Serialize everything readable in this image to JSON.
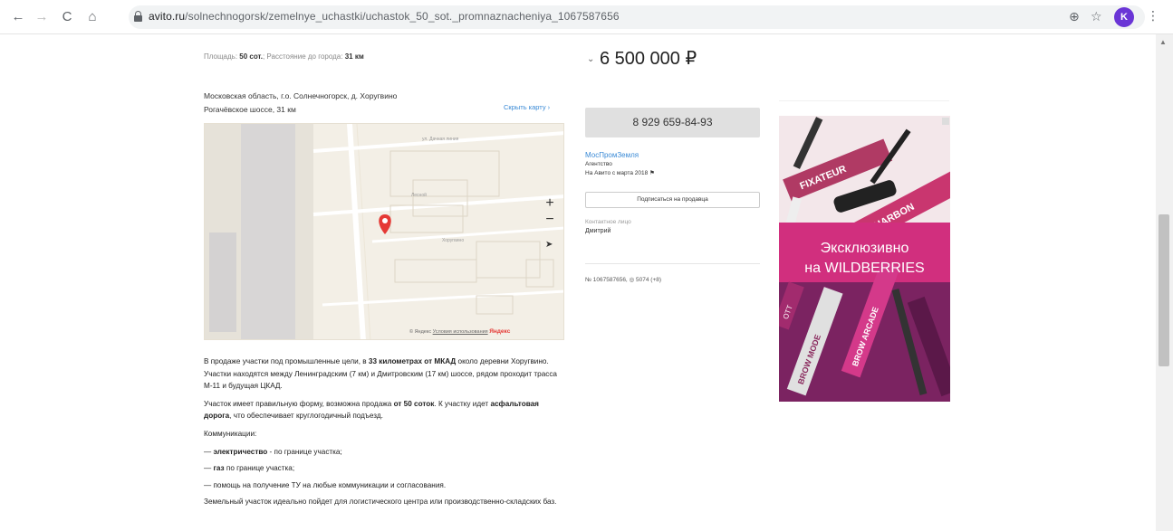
{
  "browser": {
    "url_host": "avito.ru",
    "url_path": "/solnechnogorsk/zemelnye_uchastki/uchastok_50_sot._promnaznacheniya_1067587656",
    "avatar_letter": "K"
  },
  "listing": {
    "meta_label_area": "Площадь:",
    "meta_value_area": "50 сот.",
    "meta_label_distance": "; Расстояние до города:",
    "meta_value_distance": "31 км",
    "address_line1": "Московская область, г.о. Солнечногорск, д. Хоругвино",
    "address_line2": "Рогачёвское шоссе, 31 км",
    "hide_map": "Скрыть карту",
    "map_credit_ya": "© Яндекс",
    "map_credit_terms": "Условия использования",
    "map_credit_logo": "Яндекс",
    "description": {
      "p1_a": "В продаже участки под промышленные цели, в ",
      "p1_b": "33 километрах от МКАД",
      "p1_c": " около деревни Хоругвино. Участки находятся между Ленинградским (7 км) и Дмитровским (17 км) шоссе, рядом проходит трасса М-11 и будущая ЦКАД.",
      "p2_a": "Участок имеет правильную форму, возможна продажа ",
      "p2_b": "от 50 соток",
      "p2_c": ". К участку идет ",
      "p2_d": "асфальтовая дорога",
      "p2_e": ", что обеспечивает круглогодичный подъезд.",
      "p3": "Коммуникации:",
      "l1_a": "— ",
      "l1_b": "электричество",
      "l1_c": " - по границе участка;",
      "l2_a": "— ",
      "l2_b": "газ",
      "l2_c": " по границе участка;",
      "l3": "— помощь на получение ТУ на любые коммуникации и согласования.",
      "p4": "Земельный участок идеально пойдет для логистического центра или производственно-складских баз."
    }
  },
  "sidebar": {
    "price": "6 500 000 ₽",
    "phone": "8 929 659-84-93",
    "seller_name": "МосПромЗемля",
    "seller_type": "Агентство",
    "seller_since": "На Авито с марта 2018",
    "subscribe": "Подписаться на продавца",
    "contact_label": "Контактное лицо",
    "contact_name": "Дмитрий",
    "ad_meta": "№ 1067587656,  ◎ 5074 (+8)"
  },
  "banner": {
    "headline_1": "Эксклюзивно",
    "headline_2": "на WILDBERRIES",
    "product_1": "FIXATEUR",
    "product_2": "CHARBON",
    "product_3": "BROW ARCADE",
    "product_4": "BROW MODE",
    "product_5": "OTT"
  }
}
